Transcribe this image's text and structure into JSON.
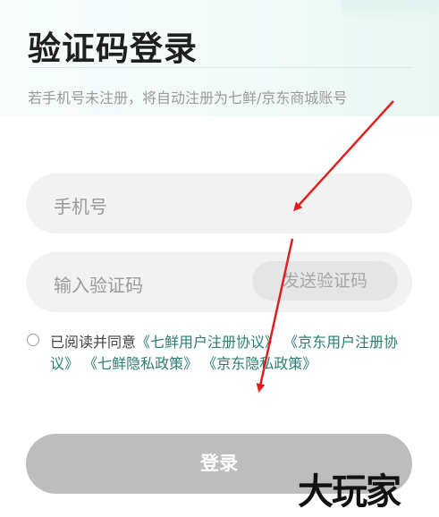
{
  "page": {
    "title": "验证码登录",
    "subtitle": "若手机号未注册，将自动注册为七鲜/京东商城账号"
  },
  "form": {
    "phone_placeholder": "手机号",
    "code_placeholder": "输入验证码",
    "send_code_label": "发送验证码"
  },
  "agreement": {
    "prefix": "已阅读并同意",
    "links": [
      "《七鲜用户注册协议》",
      "《京东用户注册协议》",
      "《七鲜隐私政策》",
      "《京东隐私政策》"
    ]
  },
  "login_button": "登录",
  "watermark": "大玩家",
  "colors": {
    "link": "#2a7d73",
    "button_disabled": "#bdbdbd",
    "annotation_arrow": "#e02020"
  }
}
